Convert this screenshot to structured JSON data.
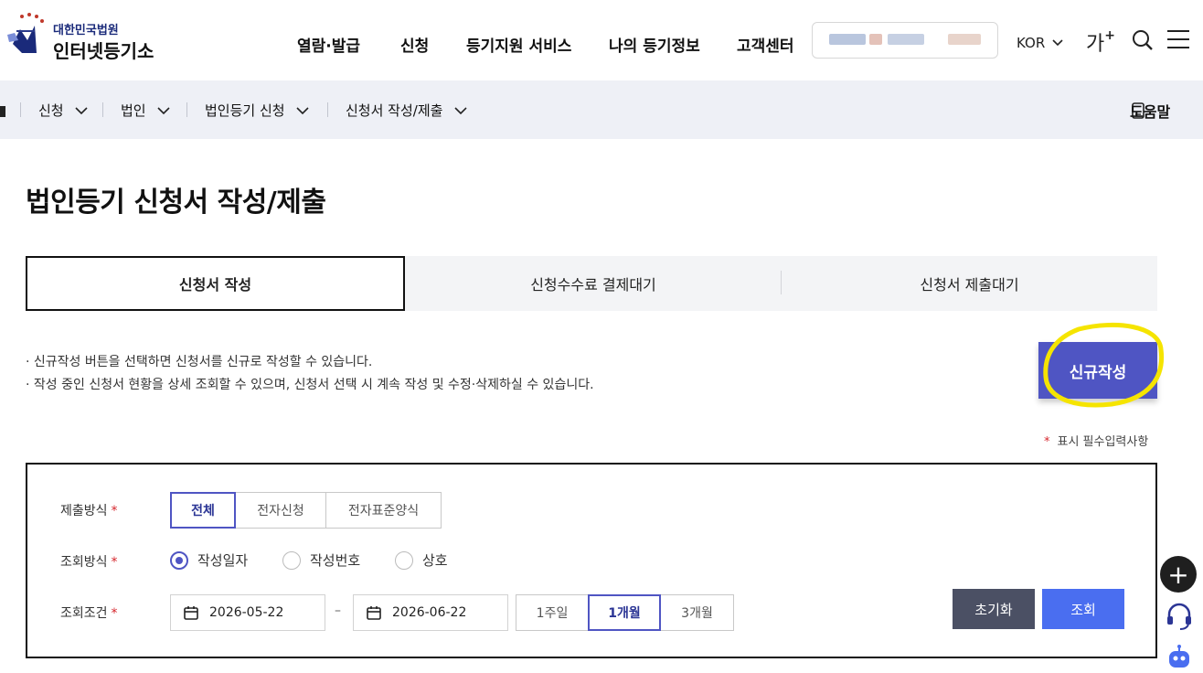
{
  "header": {
    "logo_top": "대한민국법원",
    "logo_main": "인터넷등기소",
    "nav": [
      "열람·발급",
      "신청",
      "등기지원 서비스",
      "나의 등기정보",
      "고객센터"
    ],
    "language": "KOR",
    "font_size_label": "가",
    "font_size_plus": "+"
  },
  "breadcrumb": {
    "items": [
      "신청",
      "법인",
      "법인등기 신청",
      "신청서 작성/제출"
    ],
    "help_label": "도움말"
  },
  "page_title": "법인등기 신청서 작성/제출",
  "tabs": [
    {
      "label": "신청서 작성",
      "active": true
    },
    {
      "label": "신청수수료 결제대기",
      "active": false
    },
    {
      "label": "신청서 제출대기",
      "active": false
    }
  ],
  "guide": [
    "· 신규작성 버튼을 선택하면 신청서를 신규로 작성할 수 있습니다.",
    "· 작성 중인 신청서 현황을 상세 조회할 수 있으며, 신청서 선택 시 계속 작성 및 수정·삭제하실 수 있습니다."
  ],
  "new_button": "신규작성",
  "required_note": {
    "star": "*",
    "text": "표시 필수입력사항"
  },
  "form": {
    "submit_method": {
      "label": "제출방식",
      "options": [
        "전체",
        "전자신청",
        "전자표준양식"
      ],
      "selected": "전체"
    },
    "query_method": {
      "label": "조회방식",
      "options": [
        "작성일자",
        "작성번호",
        "상호"
      ],
      "selected": "작성일자"
    },
    "query_condition": {
      "label": "조회조건",
      "start_date": "2026-05-22",
      "separator": "–",
      "end_date": "2026-06-22",
      "periods": [
        "1주일",
        "1개월",
        "3개월"
      ],
      "selected_period": "1개월"
    },
    "required_star": "*",
    "reset_button": "초기화",
    "search_button": "조회"
  },
  "colors": {
    "accent": "#4f55c3",
    "search_button": "#4a6ef0",
    "reset_button": "#4b5064",
    "crumb_bg": "#eef0f6",
    "required": "#d6272d",
    "highlight_marker": "#f5e400"
  },
  "icons": {
    "header": [
      "court-emblem-icon",
      "chevron-down-icon",
      "search-icon",
      "menu-icon"
    ],
    "breadcrumb": [
      "home-icon",
      "chevron-down-icon",
      "help-book-icon"
    ],
    "form": [
      "calendar-icon"
    ],
    "floating": [
      "plus-icon",
      "headset-icon",
      "chatbot-icon"
    ]
  }
}
